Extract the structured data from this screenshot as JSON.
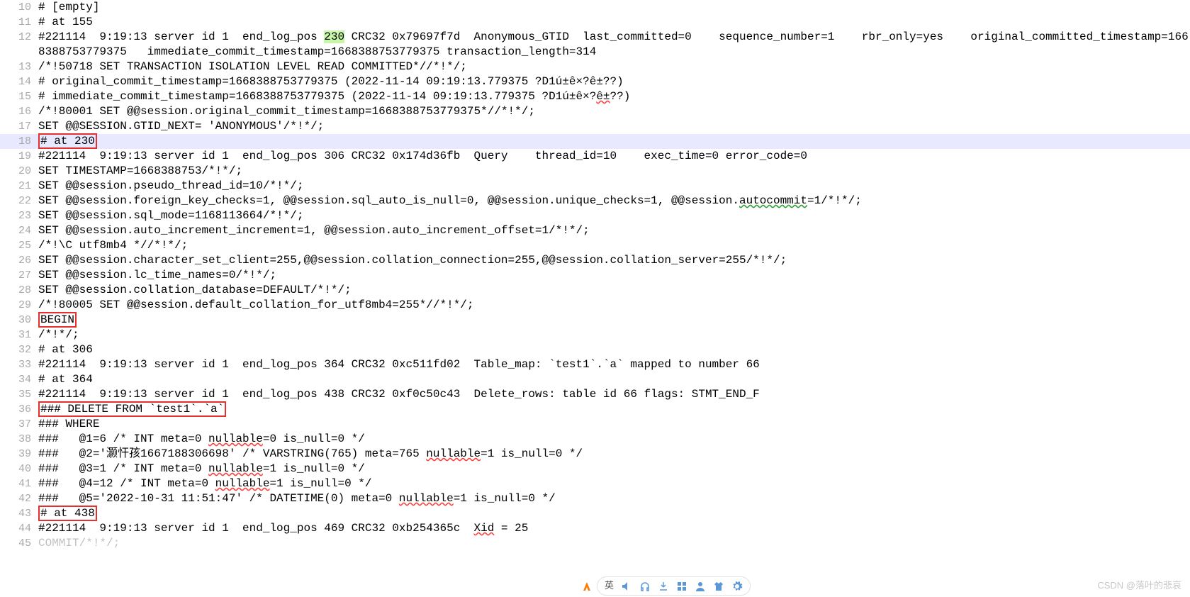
{
  "lines": [
    {
      "n": 10,
      "segs": [
        {
          "t": "# [empty]"
        }
      ]
    },
    {
      "n": 11,
      "segs": [
        {
          "t": "# at 155"
        }
      ]
    },
    {
      "n": 12,
      "wrap": true,
      "segs": [
        {
          "t": "#221114  9:19:13 server id 1  end_log_pos "
        },
        {
          "t": "230",
          "cls": "hl-230"
        },
        {
          "t": " CRC32 0x79697f7d  Anonymous_GTID  last_committed=0    sequence_number=1    rbr_only=yes    original_committed_timestamp=1668388753779375   immediate_commit_timestamp=1668388753779375 transaction_length=314"
        }
      ]
    },
    {
      "n": 13,
      "segs": [
        {
          "t": "/*!50718 SET TRANSACTION ISOLATION LEVEL READ COMMITTED*//*!*/;"
        }
      ]
    },
    {
      "n": 14,
      "segs": [
        {
          "t": "# original_commit_timestamp=1668388753779375 (2022-11-14 09:19:13.779375 ?D1ú±ê×?ê±??)"
        }
      ]
    },
    {
      "n": 15,
      "segs": [
        {
          "t": "# immediate_commit_timestamp=1668388753779375 (2022-11-14 09:19:13.779375 ?D1ú±ê×?"
        },
        {
          "t": "ê±",
          "cls": "squiggle-red"
        },
        {
          "t": "??)"
        }
      ]
    },
    {
      "n": 16,
      "segs": [
        {
          "t": "/*!80001 SET @@session.original_commit_timestamp=1668388753779375*//*!*/;"
        }
      ]
    },
    {
      "n": 17,
      "segs": [
        {
          "t": "SET @@SESSION.GTID_NEXT= 'ANONYMOUS'/*!*/;"
        }
      ]
    },
    {
      "n": 18,
      "cls": "current-line",
      "segs": [
        {
          "t": "# at 230",
          "cls": "redbox"
        }
      ]
    },
    {
      "n": 19,
      "segs": [
        {
          "t": "#221114  9:19:13 server id 1  end_log_pos 306 CRC32 0x174d36fb  Query    thread_id=10    exec_time=0 error_code=0"
        }
      ]
    },
    {
      "n": 20,
      "segs": [
        {
          "t": "SET TIMESTAMP=1668388753/*!*/;"
        }
      ]
    },
    {
      "n": 21,
      "segs": [
        {
          "t": "SET @@session.pseudo_thread_id=10/*!*/;"
        }
      ]
    },
    {
      "n": 22,
      "segs": [
        {
          "t": "SET @@session.foreign_key_checks=1, @@session.sql_auto_is_null=0, @@session.unique_checks=1, @@session."
        },
        {
          "t": "autocommit",
          "cls": "squiggle-green"
        },
        {
          "t": "=1/*!*/;"
        }
      ]
    },
    {
      "n": 23,
      "segs": [
        {
          "t": "SET @@session.sql_mode=1168113664/*!*/;"
        }
      ]
    },
    {
      "n": 24,
      "segs": [
        {
          "t": "SET @@session.auto_increment_increment=1, @@session.auto_increment_offset=1/*!*/;"
        }
      ]
    },
    {
      "n": 25,
      "segs": [
        {
          "t": "/*!\\C utf8mb4 *//*!*/;"
        }
      ]
    },
    {
      "n": 26,
      "segs": [
        {
          "t": "SET @@session.character_set_client=255,@@session.collation_connection=255,@@session.collation_server=255/*!*/;"
        }
      ]
    },
    {
      "n": 27,
      "segs": [
        {
          "t": "SET @@session.lc_time_names=0/*!*/;"
        }
      ]
    },
    {
      "n": 28,
      "segs": [
        {
          "t": "SET @@session.collation_database=DEFAULT/*!*/;"
        }
      ]
    },
    {
      "n": 29,
      "segs": [
        {
          "t": "/*!80005 SET @@session.default_collation_for_utf8mb4=255*//*!*/;"
        }
      ]
    },
    {
      "n": 30,
      "segs": [
        {
          "t": "BEGIN",
          "cls": "redbox"
        }
      ]
    },
    {
      "n": 31,
      "segs": [
        {
          "t": "/*!*/;"
        }
      ]
    },
    {
      "n": 32,
      "segs": [
        {
          "t": "# at 306"
        }
      ]
    },
    {
      "n": 33,
      "segs": [
        {
          "t": "#221114  9:19:13 server id 1  end_log_pos 364 CRC32 0xc511fd02  Table_map: `test1`.`a` mapped to number 66"
        }
      ]
    },
    {
      "n": 34,
      "segs": [
        {
          "t": "# at 364"
        }
      ]
    },
    {
      "n": 35,
      "segs": [
        {
          "t": "#221114  9:19:13 server id 1  end_log_pos 438 CRC32 0xf0c50c43  Delete_rows: table id 66 flags: STMT_END_F"
        }
      ]
    },
    {
      "n": 36,
      "segs": [
        {
          "t": "### DELETE FROM `test1`.`a`",
          "cls": "redbox"
        }
      ]
    },
    {
      "n": 37,
      "segs": [
        {
          "t": "### WHERE"
        }
      ]
    },
    {
      "n": 38,
      "segs": [
        {
          "t": "###   @1=6 /* INT meta=0 "
        },
        {
          "t": "nullable",
          "cls": "squiggle-red"
        },
        {
          "t": "=0 is_null=0 */"
        }
      ]
    },
    {
      "n": 39,
      "segs": [
        {
          "t": "###   @2='灏忓孩1667188306698' /* VARSTRING(765) meta=765 "
        },
        {
          "t": "nullable",
          "cls": "squiggle-red"
        },
        {
          "t": "=1 is_null=0 */"
        }
      ]
    },
    {
      "n": 40,
      "segs": [
        {
          "t": "###   @3=1 /* INT meta=0 "
        },
        {
          "t": "nullable",
          "cls": "squiggle-red"
        },
        {
          "t": "=1 is_null=0 */"
        }
      ]
    },
    {
      "n": 41,
      "segs": [
        {
          "t": "###   @4=12 /* INT meta=0 "
        },
        {
          "t": "nullable",
          "cls": "squiggle-red"
        },
        {
          "t": "=1 is_null=0 */"
        }
      ]
    },
    {
      "n": 42,
      "segs": [
        {
          "t": "###   @5='2022-10-31 11:51:47' /* DATETIME(0) meta=0 "
        },
        {
          "t": "nullable",
          "cls": "squiggle-red"
        },
        {
          "t": "=1 is_null=0 */"
        }
      ]
    },
    {
      "n": 43,
      "segs": [
        {
          "t": "# at 438",
          "cls": "redbox"
        }
      ]
    },
    {
      "n": 44,
      "segs": [
        {
          "t": "#221114  9:19:13 server id 1  end_log_pos 469 CRC32 0xb254365c  "
        },
        {
          "t": "Xid",
          "cls": "squiggle-red"
        },
        {
          "t": " = 25"
        }
      ]
    },
    {
      "n": 45,
      "segs": [
        {
          "t": "COMMIT/*!*/;"
        }
      ],
      "faded": true
    }
  ],
  "watermark": "CSDN @落叶的悲哀",
  "toolbar": {
    "label": "英",
    "icons": [
      "sound-icon",
      "headphones-icon",
      "download-icon",
      "grid-icon",
      "people-icon",
      "shirt-icon",
      "settings-icon"
    ]
  }
}
